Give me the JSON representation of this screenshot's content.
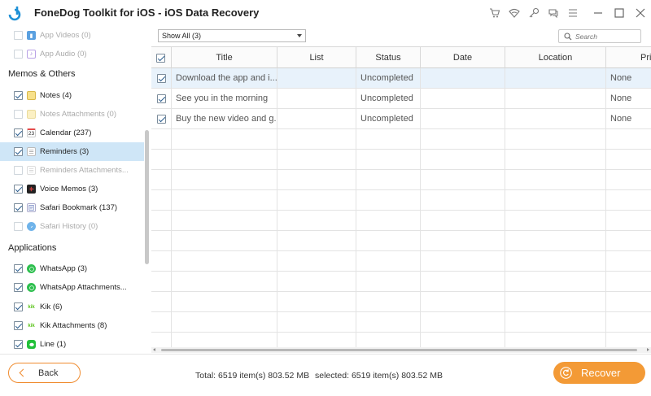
{
  "window": {
    "title": "FoneDog Toolkit for iOS - iOS Data Recovery",
    "toolbar_icons": [
      "cart-icon",
      "wifi-icon",
      "key-icon",
      "chat-icon",
      "menu-icon"
    ],
    "controls": [
      "minimize-icon",
      "maximize-icon",
      "close-icon"
    ]
  },
  "sidebar": {
    "items_top": [
      {
        "label": "App Videos (0)",
        "checked": false,
        "disabled": true,
        "icon": "clapper-icon"
      },
      {
        "label": "App Audio (0)",
        "checked": false,
        "disabled": true,
        "icon": "music-icon"
      }
    ],
    "section_memos": "Memos & Others",
    "items_memos": [
      {
        "label": "Notes (4)",
        "checked": true,
        "disabled": false,
        "icon": "notes-icon"
      },
      {
        "label": "Notes Attachments (0)",
        "checked": false,
        "disabled": true,
        "icon": "notes-icon"
      },
      {
        "label": "Calendar (237)",
        "checked": true,
        "disabled": false,
        "icon": "calendar-icon",
        "icon_text": "23"
      },
      {
        "label": "Reminders (3)",
        "checked": true,
        "disabled": false,
        "selected": true,
        "icon": "reminders-icon"
      },
      {
        "label": "Reminders Attachments...",
        "checked": false,
        "disabled": true,
        "icon": "reminders-icon"
      },
      {
        "label": "Voice Memos (3)",
        "checked": true,
        "disabled": false,
        "icon": "voice-memo-icon"
      },
      {
        "label": "Safari Bookmark (137)",
        "checked": true,
        "disabled": false,
        "icon": "safari-icon"
      },
      {
        "label": "Safari History (0)",
        "checked": false,
        "disabled": true,
        "icon": "safari-icon"
      }
    ],
    "section_apps": "Applications",
    "items_apps": [
      {
        "label": "WhatsApp (3)",
        "checked": true,
        "disabled": false,
        "icon": "whatsapp-icon"
      },
      {
        "label": "WhatsApp Attachments...",
        "checked": true,
        "disabled": false,
        "icon": "whatsapp-icon"
      },
      {
        "label": "Kik (6)",
        "checked": true,
        "disabled": false,
        "icon": "kik-icon",
        "icon_text": "kik"
      },
      {
        "label": "Kik Attachments (8)",
        "checked": true,
        "disabled": false,
        "icon": "kik-icon",
        "icon_text": "kik"
      },
      {
        "label": "Line (1)",
        "checked": true,
        "disabled": false,
        "icon": "line-icon"
      }
    ]
  },
  "toolbar": {
    "filter_value": "Show All (3)",
    "search_placeholder": "Search"
  },
  "table": {
    "columns": [
      "Title",
      "List",
      "Status",
      "Date",
      "Location",
      "Pri"
    ],
    "rows": [
      {
        "checked": true,
        "selected": true,
        "title": "Download the app and i...",
        "list": "",
        "status": "Uncompleted",
        "date": "",
        "location": "",
        "priority": "None"
      },
      {
        "checked": true,
        "selected": false,
        "title": "See you in the morning",
        "list": "",
        "status": "Uncompleted",
        "date": "",
        "location": "",
        "priority": "None"
      },
      {
        "checked": true,
        "selected": false,
        "title": "Buy the new video and g...",
        "list": "",
        "status": "Uncompleted",
        "date": "",
        "location": "",
        "priority": "None"
      }
    ],
    "empty_rows": 11
  },
  "footer": {
    "back_label": "Back",
    "total_text": "Total: 6519 item(s) 803.52 MB",
    "selected_text": "selected: 6519 item(s) 803.52 MB",
    "recover_label": "Recover"
  },
  "colors": {
    "accent": "#f39a36",
    "selection": "#cfe6f7",
    "row_selection": "#e8f2fb",
    "logo_blue": "#1e90d6"
  }
}
